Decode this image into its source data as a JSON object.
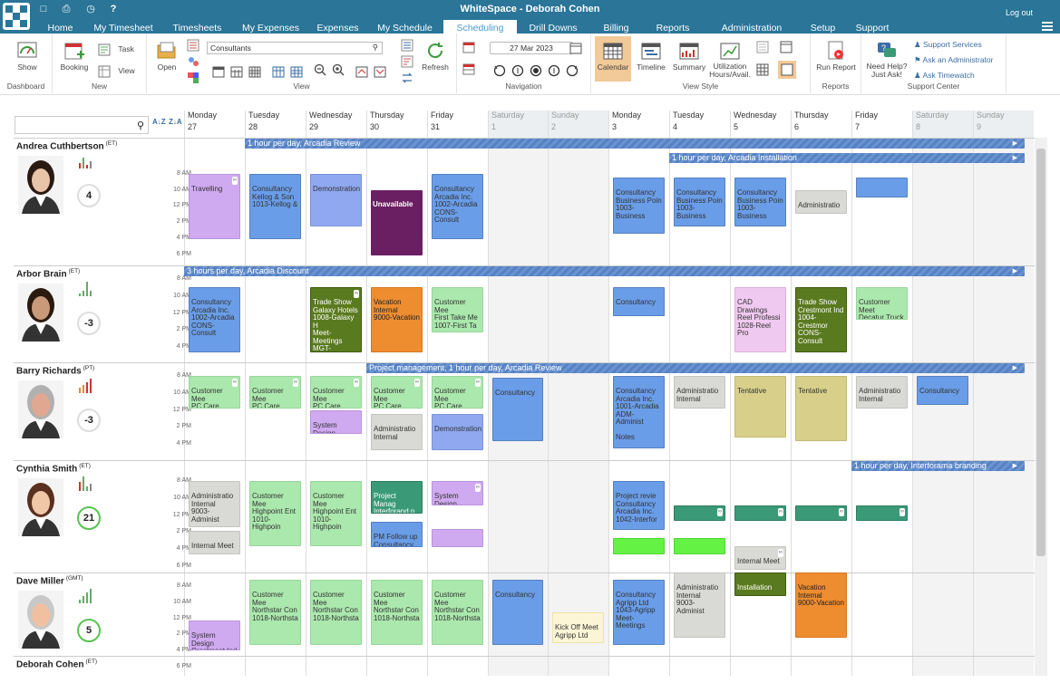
{
  "app": {
    "title": "WhiteSpace - Deborah Cohen",
    "logout": "Log out"
  },
  "menu": [
    {
      "label": "Home"
    },
    {
      "label": "My Timesheet"
    },
    {
      "label": "Timesheets"
    },
    {
      "label": "My Expenses"
    },
    {
      "label": "Expenses"
    },
    {
      "label": "My Schedule"
    },
    {
      "label": "Scheduling"
    },
    {
      "label": "Drill Downs"
    },
    {
      "label": "Billing"
    },
    {
      "label": "Reports"
    },
    {
      "label": "Administration"
    },
    {
      "label": "Setup"
    },
    {
      "label": "Support"
    }
  ],
  "ribbon": {
    "dashboard": {
      "show": "Show",
      "label": "Dashboard"
    },
    "new": {
      "booking": "Booking",
      "task": "Task",
      "view": "View",
      "label": "New"
    },
    "view": {
      "open": "Open",
      "search_value": "Consultants",
      "refresh": "Refresh",
      "label": "View"
    },
    "navigation": {
      "date": "27 Mar 2023",
      "label": "Navigation"
    },
    "view_style": {
      "calendar": "Calendar",
      "timeline": "Timeline",
      "summary": "Summary",
      "utilization": "Utilization Hours/Avail.",
      "label": "View Style"
    },
    "reports": {
      "run": "Run Report",
      "label": "Reports"
    },
    "support": {
      "need_help": "Need Help? Just Ask!",
      "services": "Support Services",
      "ask_admin": "Ask an Administrator",
      "ask_timewatch": "Ask Timewatch",
      "label": "Support Center"
    }
  },
  "days": [
    {
      "name": "Monday",
      "num": "27"
    },
    {
      "name": "Tuesday",
      "num": "28"
    },
    {
      "name": "Wednesday",
      "num": "29"
    },
    {
      "name": "Thursday",
      "num": "30"
    },
    {
      "name": "Friday",
      "num": "31"
    },
    {
      "name": "Saturday",
      "num": "1"
    },
    {
      "name": "Sunday",
      "num": "2"
    },
    {
      "name": "Monday",
      "num": "3"
    },
    {
      "name": "Tuesday",
      "num": "4"
    },
    {
      "name": "Wednesday",
      "num": "5"
    },
    {
      "name": "Thursday",
      "num": "6"
    },
    {
      "name": "Friday",
      "num": "7"
    },
    {
      "name": "Saturday",
      "num": "8"
    },
    {
      "name": "Sunday",
      "num": "9"
    }
  ],
  "time_labels": [
    "8 AM",
    "10 AM",
    "12 PM",
    "2 PM",
    "4 PM",
    "6 PM"
  ],
  "resources": [
    {
      "name": "Andrea Cuthbertson",
      "tz": "(ET)",
      "gauge": "4",
      "gauge_color": "#dddddd",
      "banners": [
        {
          "text": "1 hour per day, Arcadia Review"
        },
        {
          "text": "1 hour per day, Arcadia Installation"
        }
      ],
      "events": [
        {
          "text": "Travelling",
          "color": "purple"
        },
        {
          "text": "Consultancy\nKellog & Son\n1013-Kellog &",
          "color": "blue"
        },
        {
          "text": "Demonstration",
          "color": "lavender"
        },
        {
          "text": "Unavailable",
          "color": "darkpurple"
        },
        {
          "text": "Consultancy\nArcadia Inc.\n1002-Arcadia\nCONS-Consult",
          "color": "blue"
        },
        {
          "text": "Consultancy\nBusiness Poin\n1003-Business",
          "color": "blue"
        },
        {
          "text": "Consultancy\nBusiness Poin\n1003-Business",
          "color": "blue"
        },
        {
          "text": "Consultancy\nBusiness Poin\n1003-Business",
          "color": "blue"
        },
        {
          "text": "Administratio",
          "color": "grey"
        },
        {
          "text": "",
          "color": "blue"
        }
      ]
    },
    {
      "name": "Arbor Brain",
      "tz": "(ET)",
      "gauge": "-3",
      "gauge_color": "#dddddd",
      "banners": [
        {
          "text": "3 hours per day, Arcadia Discount"
        }
      ],
      "events": [
        {
          "text": "Consultancy\nArcadia Inc.\n1002-Arcadia\nCONS-Consult",
          "color": "blue"
        },
        {
          "text": "Trade Show\nGalaxy Hotels\n1008-Galaxy H\nMeet-Meetings\nMGT-Managen",
          "color": "olive"
        },
        {
          "text": "Vacation\nInternal\n9000-Vacation",
          "color": "orange"
        },
        {
          "text": "Customer Mee\nFirst Take Me\n1007-First Ta",
          "color": "green"
        },
        {
          "text": "Consultancy",
          "color": "blue"
        },
        {
          "text": "CAD Drawings\nReel Professi\n1028-Reel Pro",
          "color": "pink"
        },
        {
          "text": "Trade Show\nCrestmont Ind\n1004-Crestmor\nCONS-Consult",
          "color": "olive"
        },
        {
          "text": "Customer Meet\nDecatur Truck",
          "color": "green"
        }
      ]
    },
    {
      "name": "Barry Richards",
      "tz": "(PT)",
      "gauge": "-3",
      "gauge_color": "#dddddd",
      "banners": [
        {
          "text": "Project management, 1 hour per day, Arcadia Review"
        }
      ],
      "events": [
        {
          "text": "Customer Mee\nPC Care Assoc",
          "color": "green"
        },
        {
          "text": "Customer Mee\nPC Care Assoc",
          "color": "green"
        },
        {
          "text": "Customer Mee\nPC Care Assoc",
          "color": "green"
        },
        {
          "text": "Customer Mee\nPC Care Assoc",
          "color": "green"
        },
        {
          "text": "Customer Mee\nPC Care Assoc",
          "color": "green"
        },
        {
          "text": "System Design",
          "color": "purple"
        },
        {
          "text": "Administratio\nInternal",
          "color": "grey"
        },
        {
          "text": "Demonstration",
          "color": "lavender"
        },
        {
          "text": "Consultancy",
          "color": "blue"
        },
        {
          "text": "Consultancy\nArcadia Inc.\n1001-Arcadia\nADM-Administ\n\nNotes",
          "color": "blue"
        },
        {
          "text": "Administratio\nInternal",
          "color": "grey"
        },
        {
          "text": "Tentative",
          "color": "khaki"
        },
        {
          "text": "Tentative",
          "color": "khaki"
        },
        {
          "text": "Administratio\nInternal",
          "color": "grey"
        },
        {
          "text": "Consultancy",
          "color": "blue"
        }
      ]
    },
    {
      "name": "Cynthia Smith",
      "tz": "(ET)",
      "gauge": "21",
      "gauge_color": "#58c450",
      "banners": [
        {
          "text": "1 hour per day, Interforama branding"
        }
      ],
      "events": [
        {
          "text": "Administratio\nInternal\n9003-Administ",
          "color": "grey"
        },
        {
          "text": "Internal Meet",
          "color": "grey"
        },
        {
          "text": "Customer Mee\nHighpoint Ent\n1010-Highpoin",
          "color": "green"
        },
        {
          "text": "Customer Mee\nHighpoint Ent\n1010-Highpoin",
          "color": "green"
        },
        {
          "text": "Project Manag\nInterforand p",
          "color": "teal"
        },
        {
          "text": "PM Follow up\nConsultancy",
          "color": "blue"
        },
        {
          "text": "System Design",
          "color": "purple"
        },
        {
          "text": "",
          "color": "purple"
        },
        {
          "text": "Project revie\nConsultancy\nArcadia Inc.\n1042-Interfor",
          "color": "blue"
        },
        {
          "text": "",
          "color": "lime"
        },
        {
          "text": "",
          "color": "teal"
        },
        {
          "text": "",
          "color": "lime"
        },
        {
          "text": "",
          "color": "teal"
        },
        {
          "text": "Internal Meet",
          "color": "grey"
        },
        {
          "text": "",
          "color": "teal"
        },
        {
          "text": "",
          "color": "teal"
        }
      ]
    },
    {
      "name": "Dave Miller",
      "tz": "(GMT)",
      "gauge": "5",
      "gauge_color": "#58c450",
      "banners": [],
      "events": [
        {
          "text": "System Design\nCrestmont Ind",
          "color": "purple"
        },
        {
          "text": "Customer Mee\nNorthstar Con\n1018-Northsta",
          "color": "green"
        },
        {
          "text": "Customer Mee\nNorthstar Con\n1018-Northsta",
          "color": "green"
        },
        {
          "text": "Customer Mee\nNorthstar Con\n1018-Northsta",
          "color": "green"
        },
        {
          "text": "Customer Mee\nNorthstar Con\n1018-Northsta",
          "color": "green"
        },
        {
          "text": "Consultancy",
          "color": "blue"
        },
        {
          "text": "Kick Off Meet\nAgripp Ltd",
          "color": "cream"
        },
        {
          "text": "Consultancy\nAgripp Ltd\n1043-Agripp\nMeet-Meetings",
          "color": "blue"
        },
        {
          "text": "Administratio\nInternal\n9003-Administ",
          "color": "grey"
        },
        {
          "text": "Installation",
          "color": "olive"
        },
        {
          "text": "Vacation\nInternal\n9000-Vacation",
          "color": "orange"
        }
      ]
    },
    {
      "name": "Deborah Cohen",
      "tz": "(ET)",
      "gauge": "",
      "gauge_color": "#dddddd",
      "banners": [],
      "events": []
    }
  ]
}
